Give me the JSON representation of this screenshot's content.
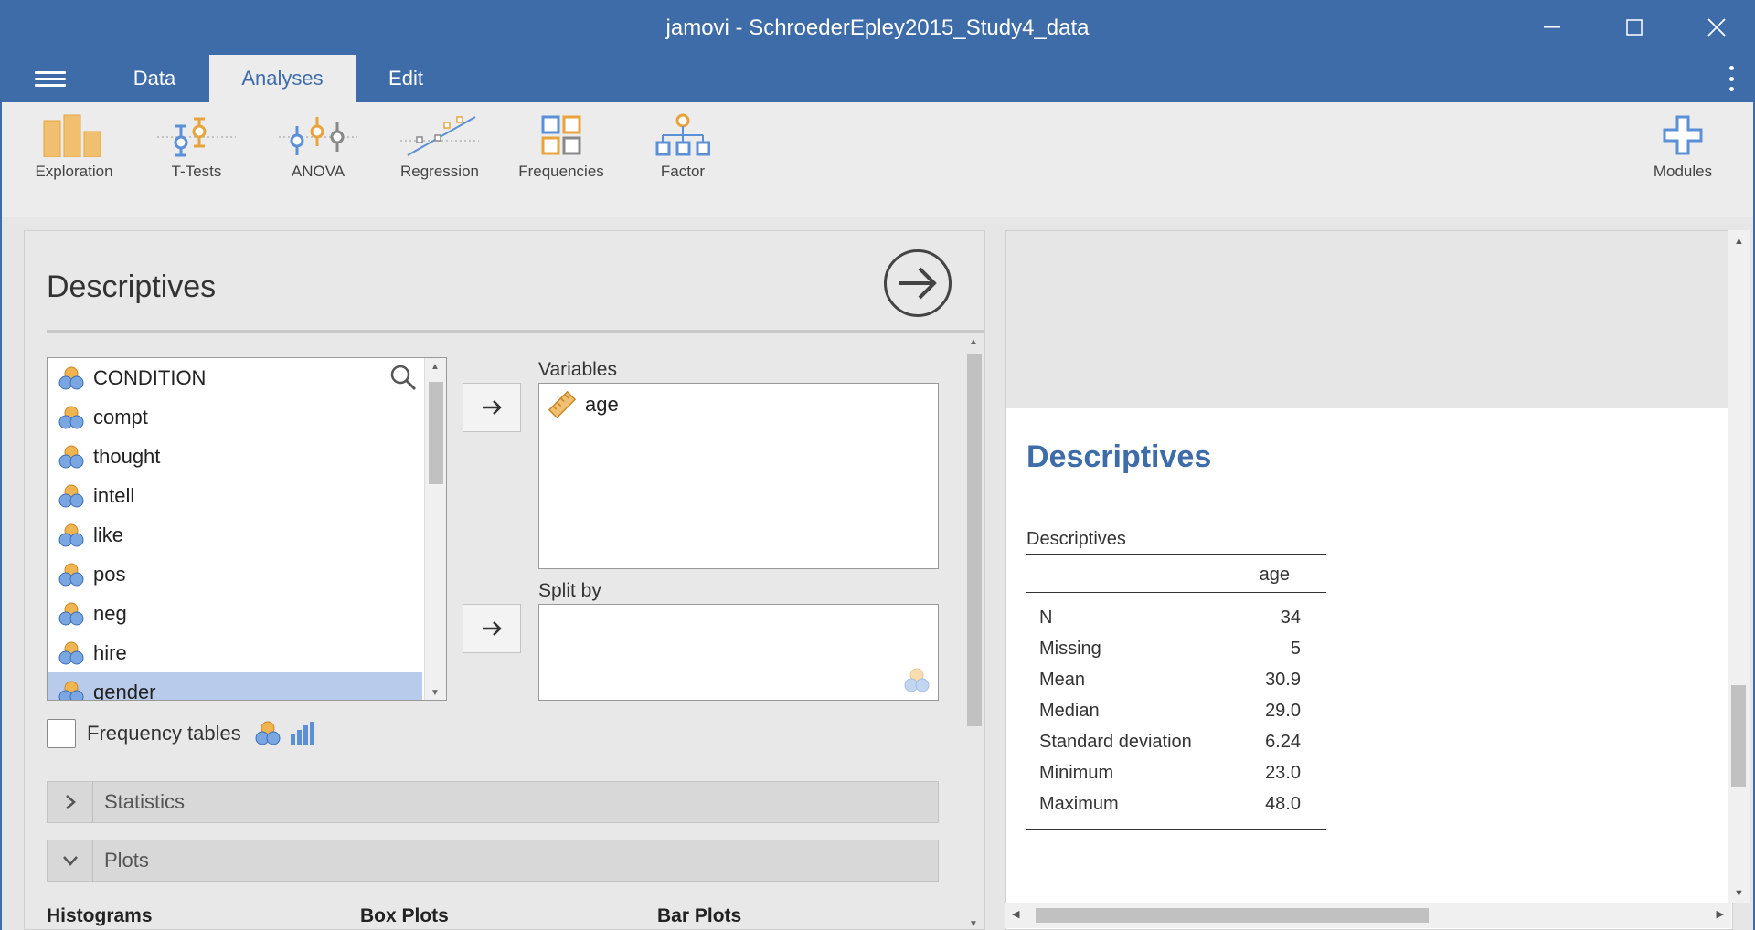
{
  "window": {
    "title": "jamovi - SchroederEpley2015_Study4_data"
  },
  "tabs": [
    {
      "label": "Data"
    },
    {
      "label": "Analyses"
    },
    {
      "label": "Edit"
    }
  ],
  "ribbon": [
    {
      "label": "Exploration",
      "icon": "exploration-icon"
    },
    {
      "label": "T-Tests",
      "icon": "t-tests-icon"
    },
    {
      "label": "ANOVA",
      "icon": "anova-icon"
    },
    {
      "label": "Regression",
      "icon": "regression-icon"
    },
    {
      "label": "Frequencies",
      "icon": "frequencies-icon"
    },
    {
      "label": "Factor",
      "icon": "factor-icon"
    },
    {
      "label": "Modules",
      "icon": "plus-icon"
    }
  ],
  "options": {
    "title": "Descriptives",
    "variables": [
      {
        "name": "CONDITION"
      },
      {
        "name": "compt"
      },
      {
        "name": "thought"
      },
      {
        "name": "intell"
      },
      {
        "name": "like"
      },
      {
        "name": "pos"
      },
      {
        "name": "neg"
      },
      {
        "name": "hire"
      },
      {
        "name": "gender"
      }
    ],
    "selected_variable": "gender",
    "variables_label": "Variables",
    "variables_assigned": [
      "age"
    ],
    "split_by_label": "Split by",
    "frequency_tables_label": "Frequency tables",
    "sections": [
      {
        "label": "Statistics",
        "expanded": false
      },
      {
        "label": "Plots",
        "expanded": true
      }
    ],
    "plot_columns": [
      "Histograms",
      "Box Plots",
      "Bar Plots"
    ]
  },
  "results": {
    "heading": "Descriptives",
    "table_title": "Descriptives",
    "column": "age",
    "rows": [
      {
        "label": "N",
        "value": "34"
      },
      {
        "label": "Missing",
        "value": "5"
      },
      {
        "label": "Mean",
        "value": "30.9"
      },
      {
        "label": "Median",
        "value": "29.0"
      },
      {
        "label": "Standard deviation",
        "value": "6.24"
      },
      {
        "label": "Minimum",
        "value": "23.0"
      },
      {
        "label": "Maximum",
        "value": "48.0"
      }
    ]
  },
  "colors": {
    "brand": "#3e6ca9",
    "nominal_icon_orange": "#e8a33d",
    "nominal_icon_blue": "#5b8fd6",
    "selected_row": "#b9cbea"
  }
}
